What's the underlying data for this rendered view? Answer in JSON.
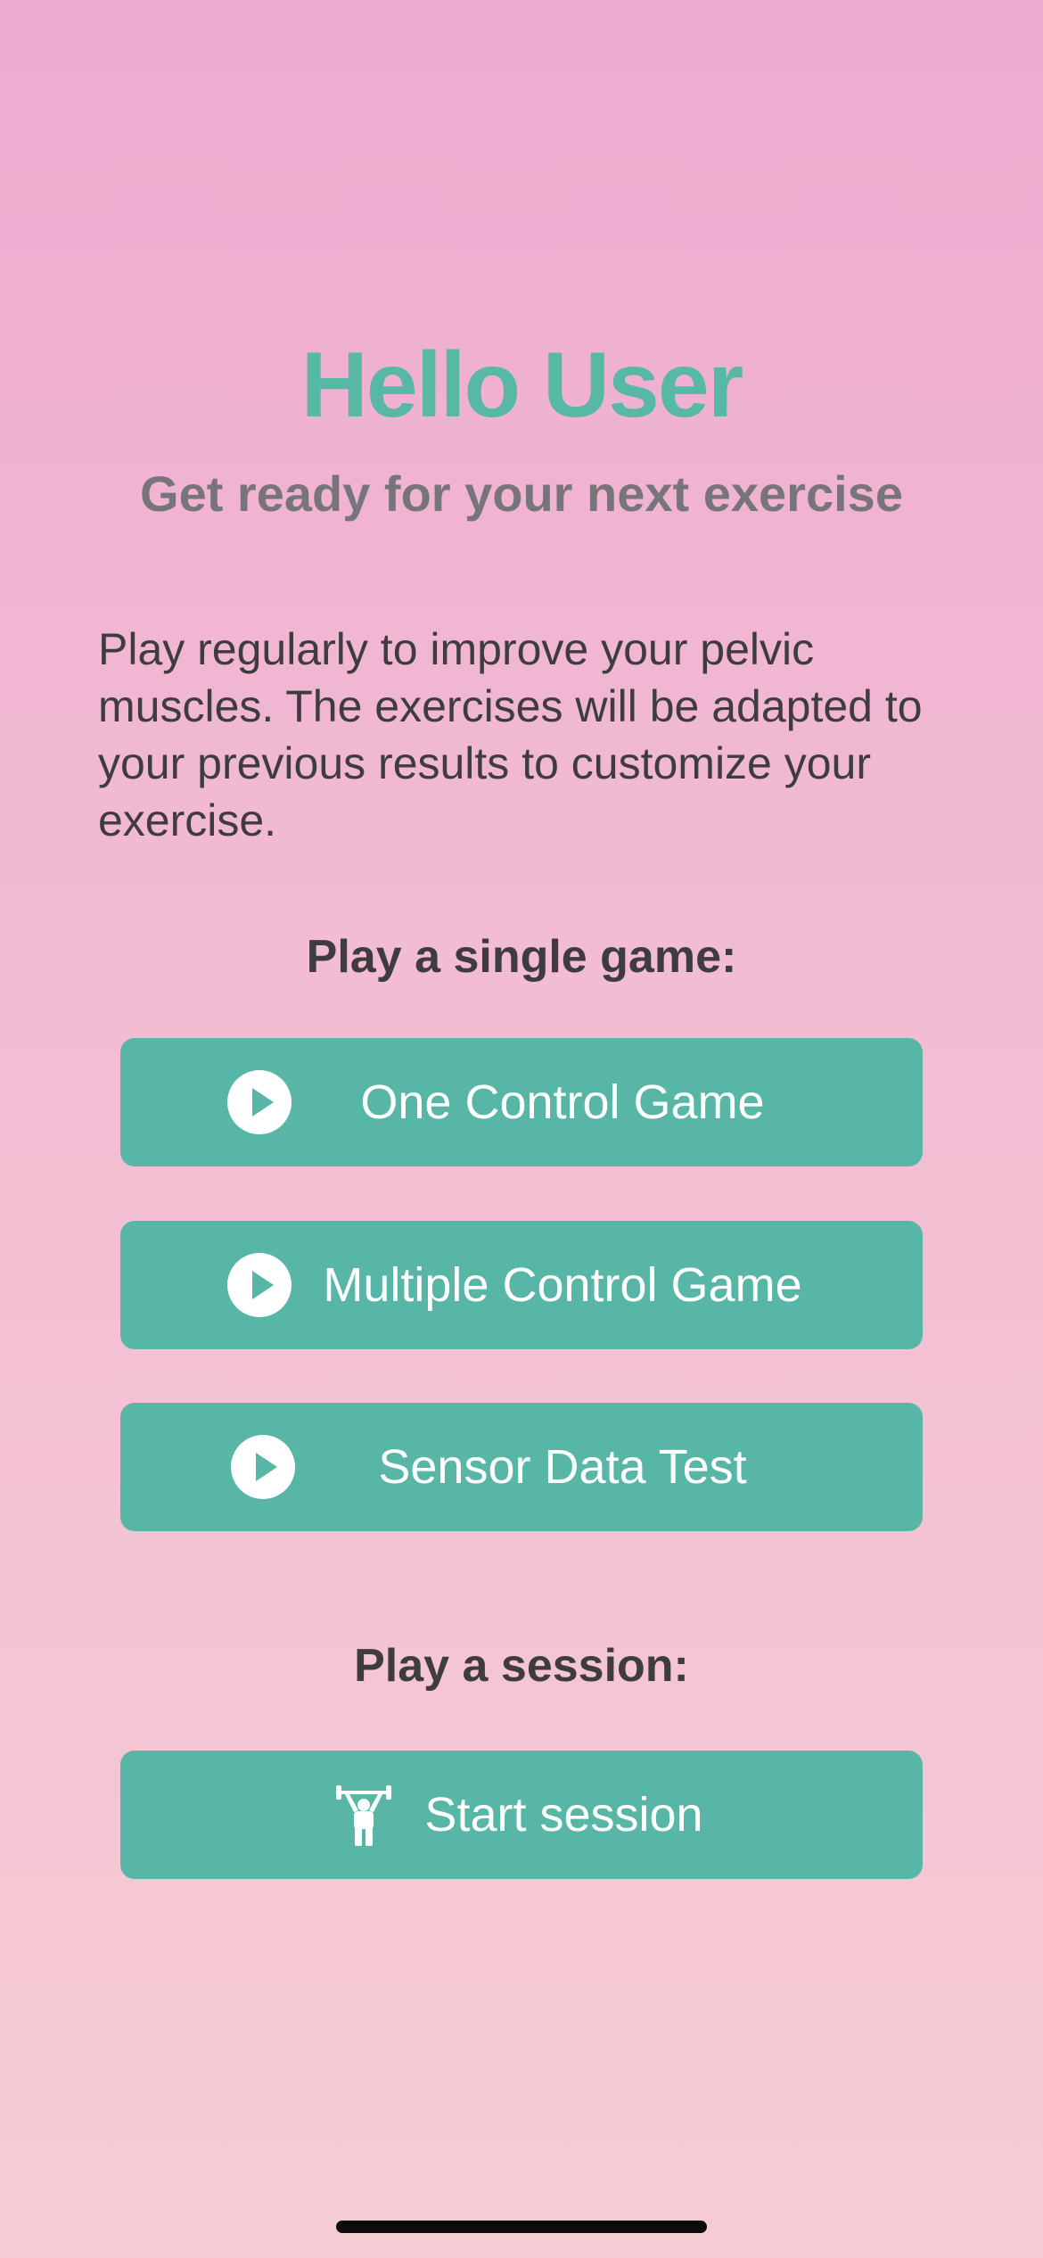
{
  "header": {
    "title": "Hello User",
    "subtitle": "Get ready for your next exercise"
  },
  "intro_text": "Play regularly to improve your pelvic muscles. The exercises will be adapted to your previous results to customize your exercise.",
  "single_game": {
    "label": "Play a single game:",
    "buttons": [
      {
        "label": "One Control Game",
        "icon": "play-circle-icon"
      },
      {
        "label": "Multiple Control Game",
        "icon": "play-circle-icon"
      },
      {
        "label": "Sensor Data Test",
        "icon": "play-circle-icon"
      }
    ]
  },
  "session": {
    "label": "Play a session:",
    "button": {
      "label": "Start session",
      "icon": "weightlifter-icon"
    }
  },
  "colors": {
    "accent": "#57b6a6",
    "background_top": "#eeaad0",
    "background_bottom": "#f6ccd4",
    "subtitle": "#77757a",
    "body_text": "#3f3c40"
  }
}
